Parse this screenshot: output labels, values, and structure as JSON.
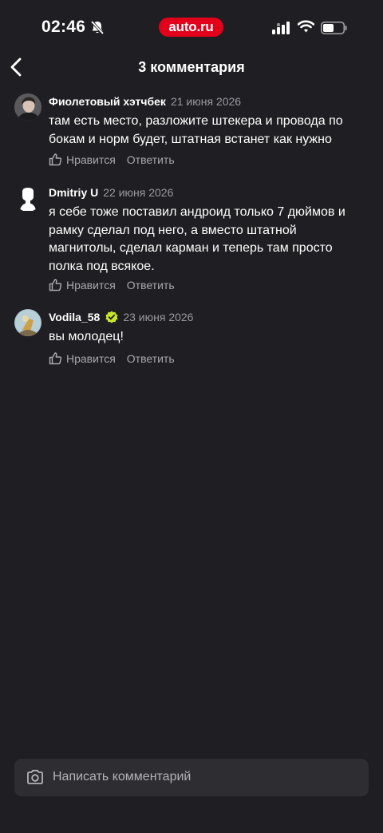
{
  "status": {
    "time": "02:46",
    "brand": "auto.ru"
  },
  "header": {
    "title": "3 комментария"
  },
  "comments": [
    {
      "author": "Фиолетовый хэтчбек",
      "date": "21 июня 2026",
      "text": "там есть место, разложите штекера и провода по бокам и норм будет, штатная встанет как нужно",
      "like_label": "Нравится",
      "reply_label": "Ответить"
    },
    {
      "author": "Dmitriy U",
      "date": "22 июня 2026",
      "text": "я себе тоже поставил андроид только 7 дюймов и рамку сделал под него, а вместо штатной магнитолы, сделал карман и теперь там просто полка под всякое.",
      "like_label": "Нравится",
      "reply_label": "Ответить"
    },
    {
      "author": "Vodila_58",
      "date": "23 июня 2026",
      "text": "вы молодец!",
      "like_label": "Нравится",
      "reply_label": "Ответить"
    }
  ],
  "composer": {
    "placeholder": "Написать комментарий"
  },
  "colors": {
    "background": "#1f1e22",
    "brand": "#e3001b",
    "verified": "#c8e62a"
  }
}
